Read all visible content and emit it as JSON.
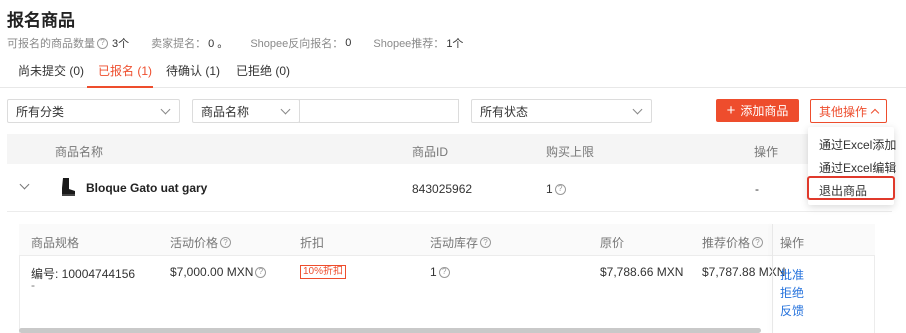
{
  "page": {
    "title": "报名商品"
  },
  "stats": {
    "eligible_label": "可报名的商品数量",
    "eligible_value": "3个",
    "seller_label": "卖家提名：",
    "seller_value": "0 。",
    "shopee_reverse_label": "Shopee反向报名：",
    "shopee_reverse_value": "0",
    "shopee_rec_label": "Shopee推荐：",
    "shopee_rec_value": "1个"
  },
  "tabs": [
    {
      "label": "尚未提交 (0)",
      "active": false
    },
    {
      "label": "已报名 (1)",
      "active": true
    },
    {
      "label": "待确认 (1)",
      "active": false
    },
    {
      "label": "已拒绝 (0)",
      "active": false
    }
  ],
  "filters": {
    "category": "所有分类",
    "field": "商品名称",
    "search_value": "",
    "status": "所有状态"
  },
  "actions": {
    "add_label": "添加商品",
    "other_label": "其他操作"
  },
  "dropdown": {
    "items": [
      "通过Excel添加",
      "通过Excel编辑",
      "退出商品"
    ]
  },
  "table": {
    "headers": [
      "商品名称",
      "商品ID",
      "购买上限",
      "操作"
    ],
    "row": {
      "name": "Bloque Gato uat gary",
      "id": "843025962",
      "limit": "1",
      "action": "-"
    }
  },
  "subtable": {
    "headers": [
      "商品规格",
      "活动价格",
      "折扣",
      "活动库存",
      "原价",
      "推荐价格",
      "操作"
    ],
    "row": {
      "spec": "编号: 10004744156",
      "spec_sub": "-",
      "price": "$7,000.00 MXN",
      "discount": "10%折扣",
      "stock": "1",
      "original": "$7,788.66 MXN",
      "recommended": "$7,787.88 MXN",
      "actions": [
        "批准",
        "拒绝",
        "反馈"
      ]
    }
  },
  "colors": {
    "accent": "#ee4d2d",
    "link": "#2673dd",
    "highlight": "#e0392b"
  },
  "icons": {
    "help": "question-circle-icon",
    "chevron": "chevron-down-icon",
    "thumbnail": "boot-thumbnail"
  }
}
